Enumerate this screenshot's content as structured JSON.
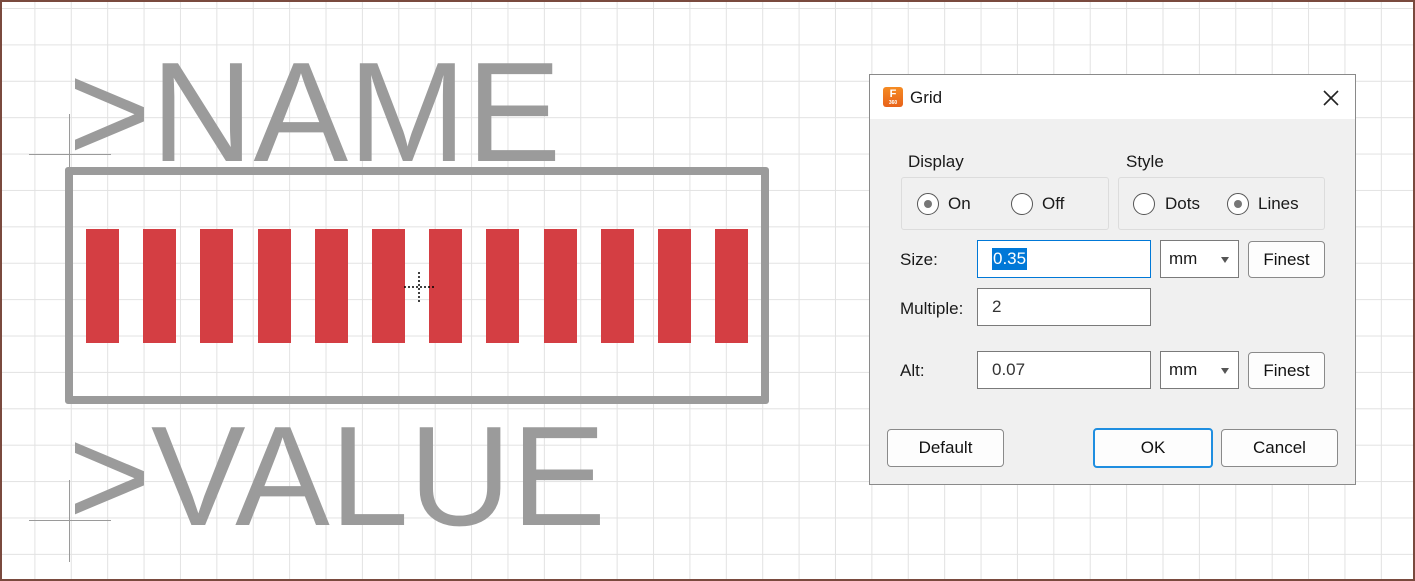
{
  "canvas": {
    "name_text": ">NAME",
    "value_text": ">VALUE",
    "pad_count": 12,
    "pad_color": "#d43e43",
    "outline_color": "#9b9b9b"
  },
  "dialog": {
    "title": "Grid",
    "app_icon_letter": "F",
    "app_icon_sub": "360",
    "display": {
      "label": "Display",
      "on_label": "On",
      "off_label": "Off",
      "selected": "On"
    },
    "style": {
      "label": "Style",
      "dots_label": "Dots",
      "lines_label": "Lines",
      "selected": "Lines"
    },
    "size": {
      "label": "Size:",
      "value": "0.35",
      "unit": "mm",
      "finest_label": "Finest"
    },
    "multiple": {
      "label": "Multiple:",
      "value": "2"
    },
    "alt": {
      "label": "Alt:",
      "value": "0.07",
      "unit": "mm",
      "finest_label": "Finest"
    },
    "buttons": {
      "default_label": "Default",
      "ok_label": "OK",
      "cancel_label": "Cancel"
    }
  }
}
